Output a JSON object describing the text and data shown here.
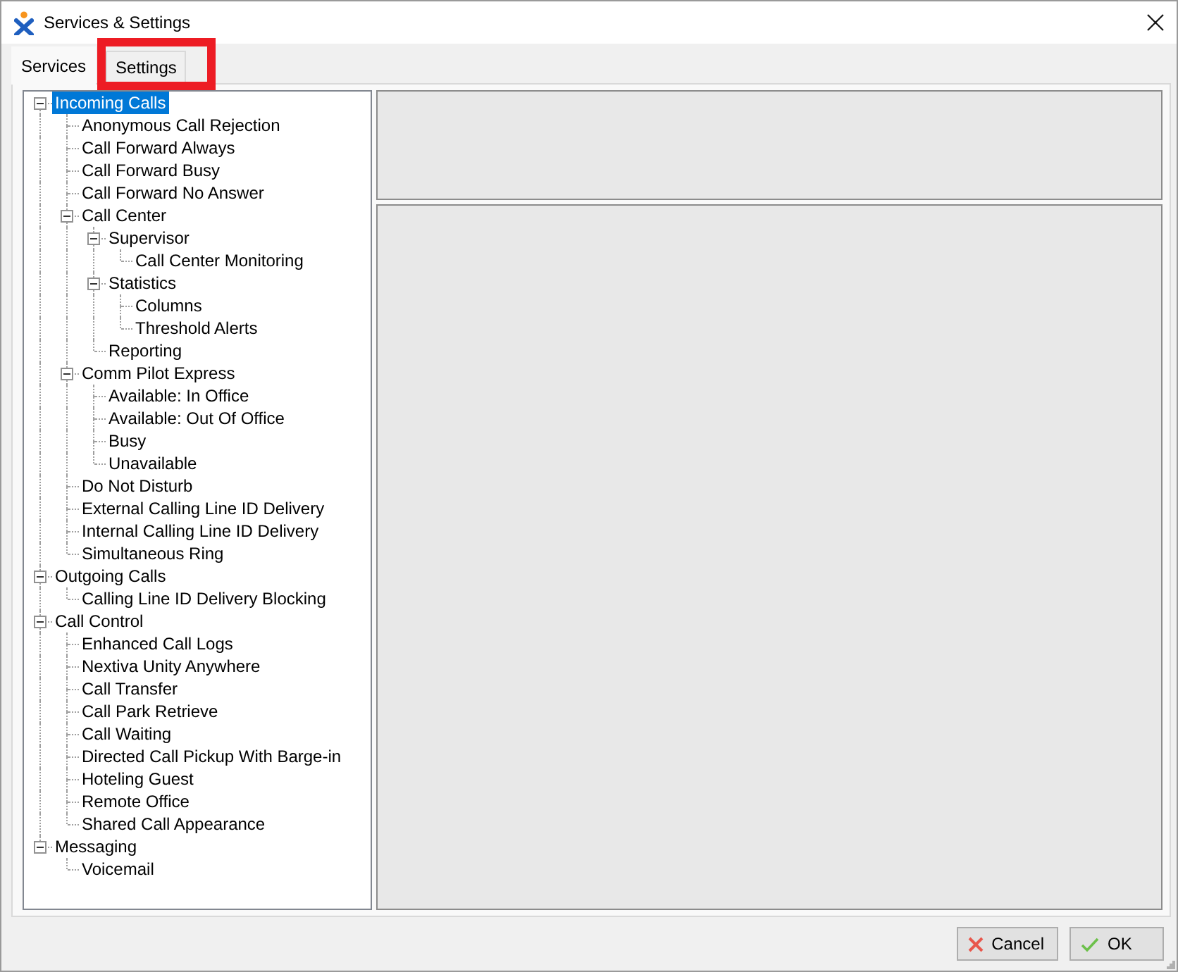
{
  "window": {
    "title": "Services & Settings"
  },
  "tabs": [
    {
      "label": "Services",
      "selected": true,
      "highlighted": false
    },
    {
      "label": "Settings",
      "selected": false,
      "highlighted": true
    }
  ],
  "tree": [
    {
      "label": "Incoming Calls",
      "selected": true,
      "expanded": true,
      "children": [
        {
          "label": "Anonymous Call Rejection",
          "selected": false
        },
        {
          "label": "Call Forward Always",
          "selected": false
        },
        {
          "label": "Call Forward Busy",
          "selected": false
        },
        {
          "label": "Call Forward No Answer",
          "selected": false
        },
        {
          "label": "Call Center",
          "selected": false,
          "expanded": true,
          "children": [
            {
              "label": "Supervisor",
              "selected": false,
              "expanded": true,
              "children": [
                {
                  "label": "Call Center Monitoring",
                  "selected": false
                }
              ]
            },
            {
              "label": "Statistics",
              "selected": false,
              "expanded": true,
              "children": [
                {
                  "label": "Columns",
                  "selected": false
                },
                {
                  "label": "Threshold Alerts",
                  "selected": false
                }
              ]
            },
            {
              "label": "Reporting",
              "selected": false
            }
          ]
        },
        {
          "label": "Comm Pilot Express",
          "selected": false,
          "expanded": true,
          "children": [
            {
              "label": "Available: In Office",
              "selected": false
            },
            {
              "label": "Available: Out Of Office",
              "selected": false
            },
            {
              "label": "Busy",
              "selected": false
            },
            {
              "label": "Unavailable",
              "selected": false
            }
          ]
        },
        {
          "label": "Do Not Disturb",
          "selected": false
        },
        {
          "label": "External Calling Line ID Delivery",
          "selected": false
        },
        {
          "label": "Internal Calling Line ID Delivery",
          "selected": false
        },
        {
          "label": "Simultaneous Ring",
          "selected": false
        }
      ]
    },
    {
      "label": "Outgoing Calls",
      "selected": false,
      "expanded": true,
      "children": [
        {
          "label": "Calling Line ID Delivery Blocking",
          "selected": false
        }
      ]
    },
    {
      "label": "Call Control",
      "selected": false,
      "expanded": true,
      "children": [
        {
          "label": "Enhanced Call Logs",
          "selected": false
        },
        {
          "label": "Nextiva Unity Anywhere",
          "selected": false
        },
        {
          "label": "Call Transfer",
          "selected": false
        },
        {
          "label": "Call Park Retrieve",
          "selected": false
        },
        {
          "label": "Call Waiting",
          "selected": false
        },
        {
          "label": "Directed Call Pickup With Barge-in",
          "selected": false
        },
        {
          "label": "Hoteling Guest",
          "selected": false
        },
        {
          "label": "Remote Office",
          "selected": false
        },
        {
          "label": "Shared Call Appearance",
          "selected": false
        }
      ]
    },
    {
      "label": "Messaging",
      "selected": false,
      "expanded": true,
      "children": [
        {
          "label": "Voicemail",
          "selected": false
        }
      ]
    }
  ],
  "buttons": [
    {
      "label": "Cancel",
      "kind": "cancel"
    },
    {
      "label": "OK",
      "kind": "ok"
    }
  ]
}
